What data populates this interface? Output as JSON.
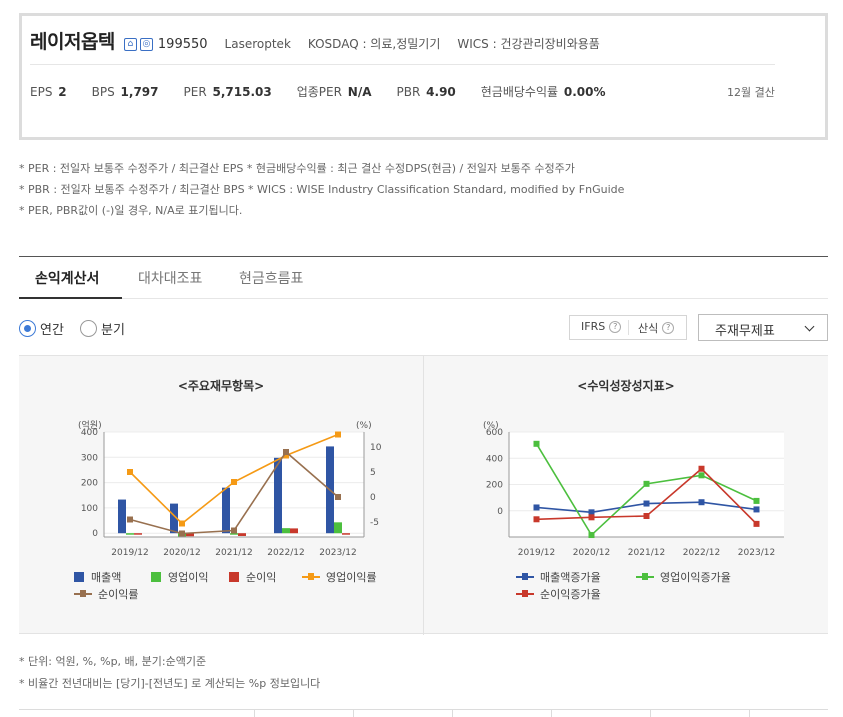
{
  "company": {
    "name": "레이저옵텍",
    "code": "199550",
    "english_name": "Laseroptek",
    "market": "KOSDAQ : 의료,정밀기기",
    "wics": "WICS : 건강관리장비와용품",
    "icon1": "⌂",
    "icon2": "◎"
  },
  "metrics": [
    {
      "label": "EPS",
      "value": "2"
    },
    {
      "label": "BPS",
      "value": "1,797"
    },
    {
      "label": "PER",
      "value": "5,715.03"
    },
    {
      "label": "업종PER",
      "value": "N/A"
    },
    {
      "label": "PBR",
      "value": "4.90"
    },
    {
      "label": "현금배당수익률",
      "value": "0.00%"
    }
  ],
  "settlement": "12월 결산",
  "notes": [
    "* PER : 전일자 보통주 수정주가 / 최근결산 EPS * 현금배당수익률 : 최근 결산 수정DPS(현금) / 전일자 보통주 수정주가",
    "* PBR : 전일자 보통주 수정주가 / 최근결산 BPS * WICS : WISE Industry Classification Standard, modified by FnGuide",
    "* PER, PBR값이 (-)일 경우, N/A로 표기됩니다."
  ],
  "tabs": [
    "손익계산서",
    "대차대조표",
    "현금흐름표"
  ],
  "period": {
    "annual": "연간",
    "quarter": "분기"
  },
  "options": {
    "ifrs": "IFRS",
    "calc": "산식",
    "help": "?"
  },
  "select_value": "주재무제표",
  "colors": {
    "blue": "#2f55a4",
    "green": "#4cbf3e",
    "red": "#c8382b",
    "orange": "#f59a15",
    "brown": "#98704f"
  },
  "chart_data": [
    {
      "type": "bar",
      "title": "<주요재무항목>",
      "y_left_label": "(억원)",
      "y_right_label": "(%)",
      "categories": [
        "2019/12",
        "2020/12",
        "2021/12",
        "2022/12",
        "2023/12"
      ],
      "y_left_ticks": [
        "400",
        "300",
        "200",
        "100",
        "0"
      ],
      "y_right_ticks": [
        "10",
        "5",
        "0",
        "-5"
      ],
      "ylim_left": [
        -15,
        400
      ],
      "ylim_right": [
        -8,
        13
      ],
      "series": [
        {
          "name": "매출액",
          "type": "bar",
          "axis": "left",
          "color": "#2f55a4",
          "values": [
            133,
            117,
            180,
            298,
            343
          ]
        },
        {
          "name": "영업이익",
          "type": "bar",
          "axis": "left",
          "color": "#4cbf3e",
          "values": [
            -4,
            -13,
            -1,
            20,
            43
          ]
        },
        {
          "name": "순이익",
          "type": "bar",
          "axis": "left",
          "color": "#c8382b",
          "values": [
            -5,
            -12,
            -11,
            19,
            -1
          ]
        },
        {
          "name": "영업이익률",
          "type": "line",
          "axis": "right",
          "color": "#f59a15",
          "values": [
            5.0,
            -5.3,
            3.0,
            8.3,
            12.5
          ]
        },
        {
          "name": "순이익률",
          "type": "line",
          "axis": "right",
          "color": "#98704f",
          "values": [
            -4.5,
            -7.3,
            -6.7,
            9.0,
            0.0
          ]
        }
      ]
    },
    {
      "type": "line",
      "title": "<수익성장성지표>",
      "y_label": "(%)",
      "categories": [
        "2019/12",
        "2020/12",
        "2021/12",
        "2022/12",
        "2023/12"
      ],
      "y_ticks": [
        "600",
        "400",
        "200",
        "0"
      ],
      "ylim": [
        -200,
        600
      ],
      "series": [
        {
          "name": "매출액증가율",
          "color": "#2f55a4",
          "values": [
            25,
            -12,
            55,
            65,
            10
          ]
        },
        {
          "name": "영업이익증가율",
          "color": "#4cbf3e",
          "values": [
            510,
            -185,
            205,
            270,
            75
          ]
        },
        {
          "name": "순이익증가율",
          "color": "#c8382b",
          "values": [
            -65,
            -50,
            -40,
            320,
            -100
          ]
        }
      ]
    }
  ],
  "footnotes": [
    "* 단위: 억원, %, %p, 배, 분기:순액기준",
    "* 비율간 전년대비는 [당기]-[전년도] 로 계산되는 %p 정보입니다"
  ]
}
